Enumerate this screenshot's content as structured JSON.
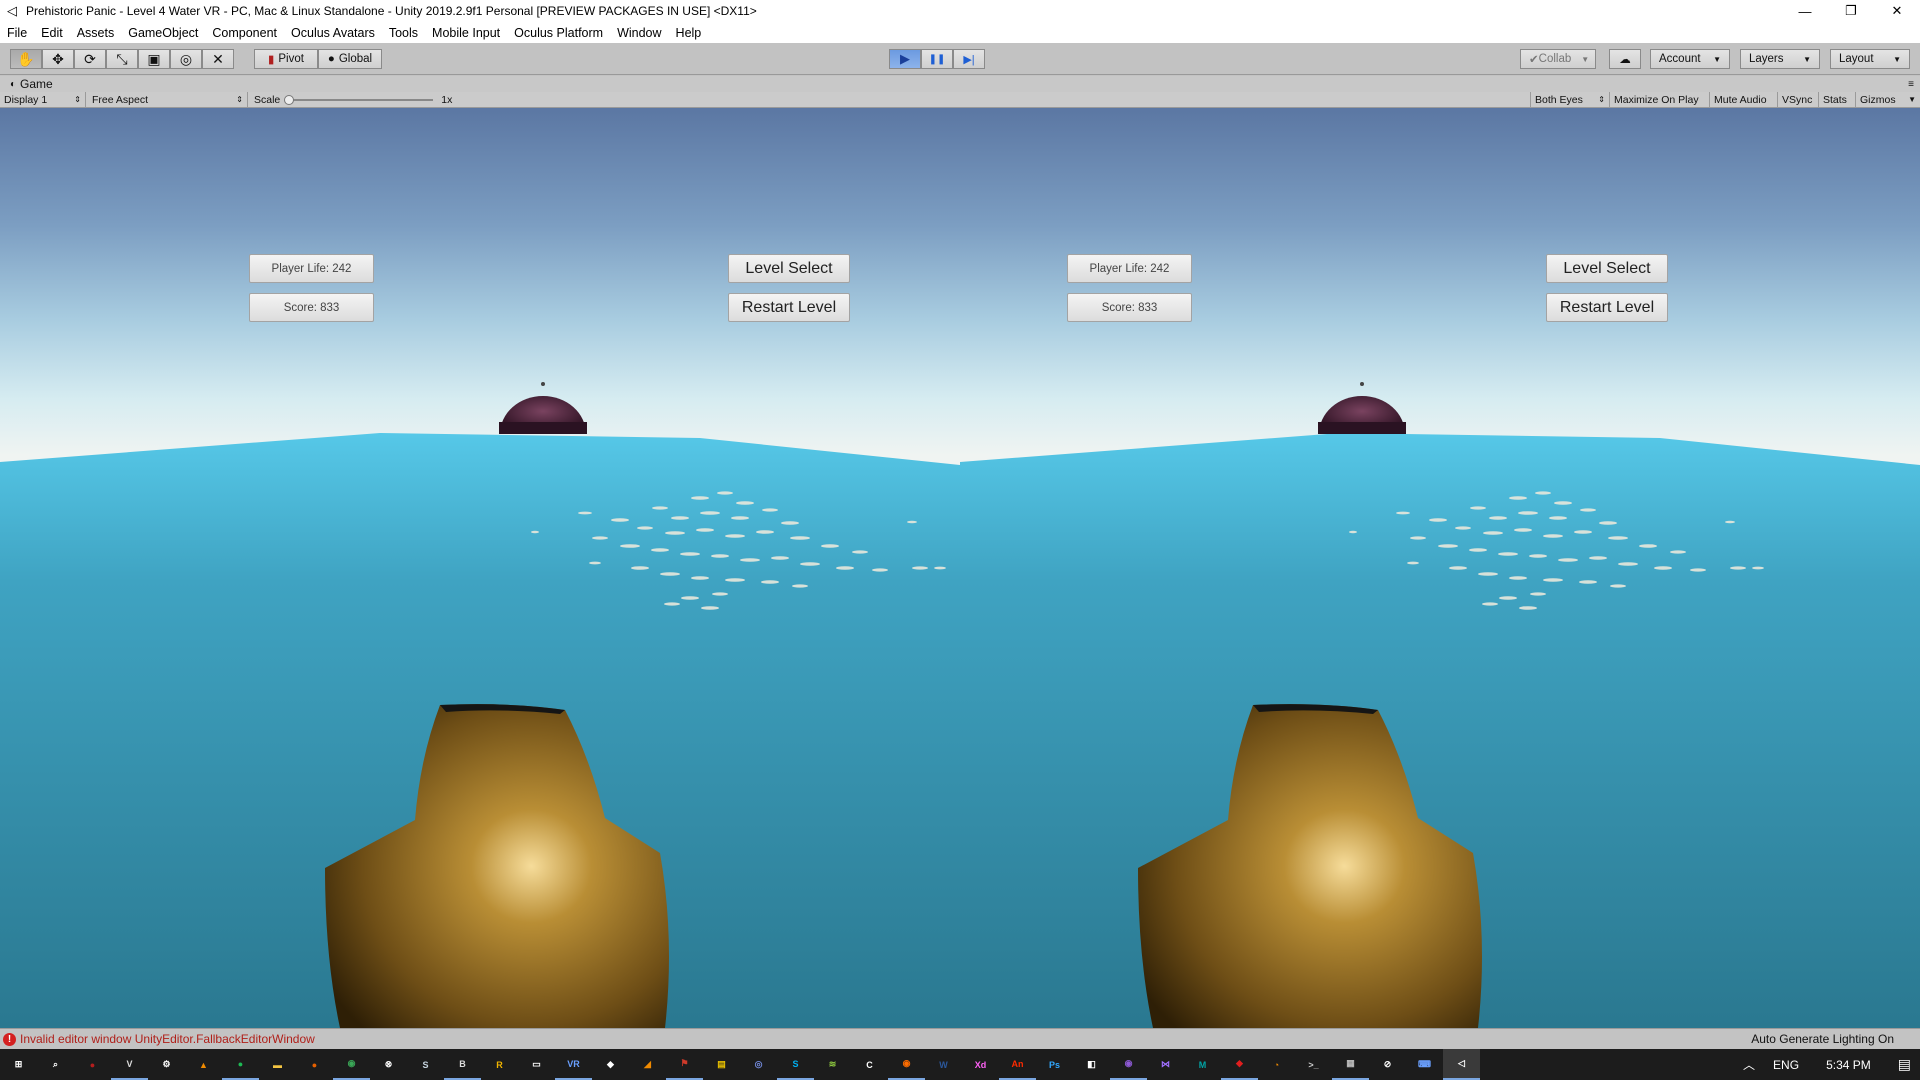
{
  "window": {
    "title": "Prehistoric Panic - Level 4 Water VR - PC, Mac & Linux Standalone - Unity 2019.2.9f1 Personal [PREVIEW PACKAGES IN USE] <DX11>",
    "controls": {
      "minimize": "—",
      "restore": "❐",
      "close": "✕"
    }
  },
  "menu": [
    "File",
    "Edit",
    "Assets",
    "GameObject",
    "Component",
    "Oculus Avatars",
    "Tools",
    "Mobile Input",
    "Oculus Platform",
    "Window",
    "Help"
  ],
  "toolbar": {
    "tools": [
      {
        "icon": "hand-tool-icon",
        "glyph": "✋"
      },
      {
        "icon": "move-tool-icon",
        "glyph": "✥"
      },
      {
        "icon": "rotate-tool-icon",
        "glyph": "⟳"
      },
      {
        "icon": "scale-tool-icon",
        "glyph": "⤡"
      },
      {
        "icon": "rect-tool-icon",
        "glyph": "▣"
      },
      {
        "icon": "transform-tool-icon",
        "glyph": "◎"
      },
      {
        "icon": "custom-tool-icon",
        "glyph": "✕"
      }
    ],
    "pivot": "Pivot",
    "global": "Global",
    "play_glyph": "▶",
    "pause_glyph": "❚❚",
    "step_glyph": "▶|",
    "collab": "Collab",
    "cloud_glyph": "☁",
    "account": "Account",
    "layers": "Layers",
    "layout": "Layout"
  },
  "game_tab": {
    "label": "Game"
  },
  "game_bar": {
    "display": "Display 1",
    "aspect": "Free Aspect",
    "scale_label": "Scale",
    "scale_value": "1x",
    "eyes": "Both Eyes",
    "maximize": "Maximize On Play",
    "mute": "Mute Audio",
    "vsync": "VSync",
    "stats": "Stats",
    "gizmos": "Gizmos"
  },
  "hud": {
    "player_life": "Player Life: 242",
    "score": "Score: 833",
    "level_select": "Level Select",
    "restart_level": "Restart Level"
  },
  "status": {
    "error": "Invalid editor window UnityEditor.FallbackEditorWindow",
    "lighting": "Auto Generate Lighting On"
  },
  "taskbar": {
    "apps": [
      {
        "name": "start",
        "color": "#ffffff",
        "text": "⊞"
      },
      {
        "name": "search",
        "color": "#ffffff",
        "text": "⌕"
      },
      {
        "name": "app-red",
        "color": "#b41e1e",
        "text": "●"
      },
      {
        "name": "visual-studio-code",
        "color": "#dddddd",
        "text": "V"
      },
      {
        "name": "settings",
        "color": "#ffffff",
        "text": "⚙"
      },
      {
        "name": "vlc",
        "color": "#f08a00",
        "text": "▲"
      },
      {
        "name": "spotify",
        "color": "#1db954",
        "text": "●"
      },
      {
        "name": "file-explorer",
        "color": "#f4c542",
        "text": "▬"
      },
      {
        "name": "firefox",
        "color": "#e66000",
        "text": "●"
      },
      {
        "name": "chrome",
        "color": "#3aa757",
        "text": "◉"
      },
      {
        "name": "xbox",
        "color": "#ffffff",
        "text": "⊗"
      },
      {
        "name": "steam",
        "color": "#c6d4df",
        "text": "S"
      },
      {
        "name": "app-b",
        "color": "#dddddd",
        "text": "B"
      },
      {
        "name": "app-yellow",
        "color": "#f0b400",
        "text": "R"
      },
      {
        "name": "oculus",
        "color": "#ffffff",
        "text": "▭"
      },
      {
        "name": "vr",
        "color": "#6aa0ff",
        "text": "VR"
      },
      {
        "name": "app-white",
        "color": "#ffffff",
        "text": "◆"
      },
      {
        "name": "app-orange",
        "color": "#f08a00",
        "text": "◢"
      },
      {
        "name": "app-red-2",
        "color": "#d03a2a",
        "text": "⚑"
      },
      {
        "name": "app-yellow-2",
        "color": "#e8c000",
        "text": "▤"
      },
      {
        "name": "discord",
        "color": "#7289da",
        "text": "◎"
      },
      {
        "name": "skype",
        "color": "#00aff0",
        "text": "S"
      },
      {
        "name": "app-green",
        "color": "#8dc63f",
        "text": "≋"
      },
      {
        "name": "app-c",
        "color": "#ffffff",
        "text": "C"
      },
      {
        "name": "app-colorful",
        "color": "#ff6d00",
        "text": "◉"
      },
      {
        "name": "word",
        "color": "#2b579a",
        "text": "W"
      },
      {
        "name": "adobe-xd",
        "color": "#ff61f6",
        "text": "Xd"
      },
      {
        "name": "adobe-animate",
        "color": "#ff2a00",
        "text": "An"
      },
      {
        "name": "photoshop",
        "color": "#31a8ff",
        "text": "Ps"
      },
      {
        "name": "app-square",
        "color": "#ffffff",
        "text": "◧"
      },
      {
        "name": "app-purple",
        "color": "#8e5ad6",
        "text": "◉"
      },
      {
        "name": "visual-studio",
        "color": "#a070ff",
        "text": "⋈"
      },
      {
        "name": "app-teal",
        "color": "#00a4a6",
        "text": "M"
      },
      {
        "name": "app-red-3",
        "color": "#e01e1e",
        "text": "◆"
      },
      {
        "name": "blender",
        "color": "#f08a00",
        "text": "◔"
      },
      {
        "name": "terminal",
        "color": "#cccccc",
        "text": ">_"
      },
      {
        "name": "app-gray",
        "color": "#bbbbbb",
        "text": "▦"
      },
      {
        "name": "app-compass",
        "color": "#ffffff",
        "text": "⊘"
      },
      {
        "name": "app-keyboard",
        "color": "#6aa0ff",
        "text": "⌨"
      },
      {
        "name": "unity",
        "color": "#ffffff",
        "text": "◁"
      }
    ],
    "language": "ENG",
    "time": "5:34 PM",
    "tray_up": "︿",
    "notifications": "▤"
  }
}
